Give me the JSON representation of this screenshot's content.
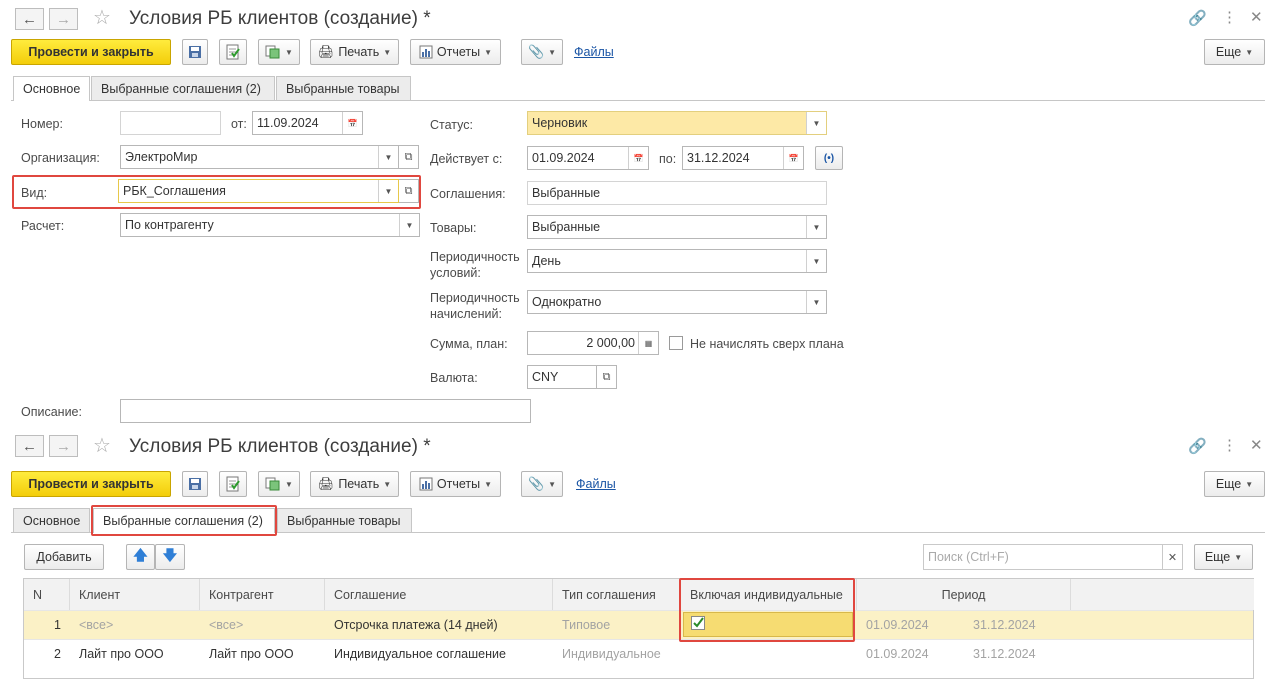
{
  "window1": {
    "title": "Условия РБ клиентов (создание) *",
    "toolbar": {
      "post_close": "Провести и закрыть",
      "print": "Печать",
      "reports": "Отчеты",
      "files": "Файлы",
      "more": "Еще"
    },
    "tabs": [
      "Основное",
      "Выбранные соглашения (2)",
      "Выбранные товары"
    ],
    "form": {
      "number_label": "Номер:",
      "number_value": "",
      "date_from_label": "от:",
      "date_value": "11.09.2024",
      "org_label": "Организация:",
      "org_value": "ЭлектроМир",
      "kind_label": "Вид:",
      "kind_value": "РБК_Соглашения",
      "calc_label": "Расчет:",
      "calc_value": "По контрагенту",
      "status_label": "Статус:",
      "status_value": "Черновик",
      "valid_label": "Действует с:",
      "valid_from": "01.09.2024",
      "valid_to_label": "по:",
      "valid_to": "31.12.2024",
      "agreements_label": "Соглашения:",
      "agreements_value": "Выбранные",
      "goods_label": "Товары:",
      "goods_value": "Выбранные",
      "cond_period_label_1": "Периодичность",
      "cond_period_label_2": "условий:",
      "cond_period_value": "День",
      "accr_period_label_1": "Периодичность",
      "accr_period_label_2": "начислений:",
      "accr_period_value": "Однократно",
      "sum_label": "Сумма, план:",
      "sum_value": "2 000,00",
      "no_over_plan": "Не начислять сверх плана",
      "currency_label": "Валюта:",
      "currency_value": "CNY",
      "desc_label": "Описание:",
      "desc_value": ""
    }
  },
  "window2": {
    "title": "Условия РБ клиентов (создание) *",
    "toolbar": {
      "post_close": "Провести и закрыть",
      "print": "Печать",
      "reports": "Отчеты",
      "files": "Файлы",
      "more": "Еще"
    },
    "tabs": [
      "Основное",
      "Выбранные соглашения (2)",
      "Выбранные товары"
    ],
    "list_toolbar": {
      "add": "Добавить",
      "search_placeholder": "Поиск (Ctrl+F)",
      "more": "Еще"
    },
    "table": {
      "headers": [
        "N",
        "Клиент",
        "Контрагент",
        "Соглашение",
        "Тип соглашения",
        "Включая индивидуальные",
        "Период"
      ],
      "rows": [
        {
          "n": "1",
          "client": "<все>",
          "counterparty": "<все>",
          "agreement": "Отсрочка платежа (14 дней)",
          "type": "Типовое",
          "include_individual": true,
          "from": "01.09.2024",
          "to": "31.12.2024"
        },
        {
          "n": "2",
          "client": "Лайт про ООО",
          "counterparty": "Лайт про ООО",
          "agreement": "Индивидуальное соглашение",
          "type": "Индивидуальное",
          "include_individual": false,
          "from": "01.09.2024",
          "to": "31.12.2024"
        }
      ]
    }
  },
  "colors": {
    "primary_button": "#f5d20e",
    "highlight": "#e0473f",
    "status_field": "#fde9a6",
    "selected_row": "#fbf1c6",
    "link": "#1a55a5"
  }
}
